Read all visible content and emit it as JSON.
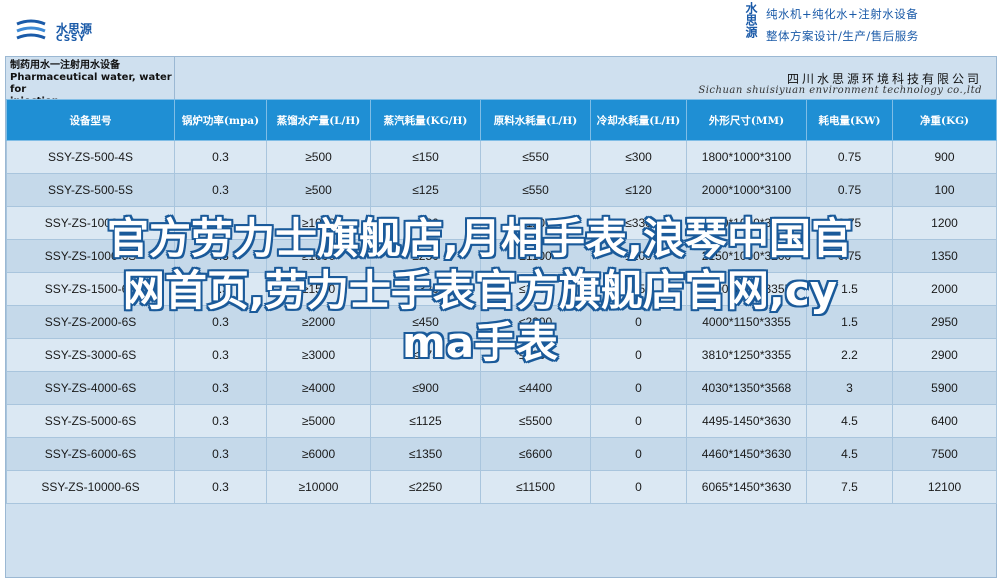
{
  "brand": {
    "name_cn": "水思源",
    "name_en": "CSSY",
    "accent": "#1a5aa8"
  },
  "slogan": {
    "vertical": "水思源",
    "line1": "纯水机+纯化水+注射水设备",
    "line2": "整体方案设计/生产/售后服务"
  },
  "sheet": {
    "title_cn": "制药用水一注射用水设备",
    "title_en_1": "Pharmaceutical water, water for",
    "title_en_2": "injection",
    "company_cn": "四川水思源环境科技有限公司",
    "company_en": "Sichuan shuisiyuan environment technology co.,ltd"
  },
  "table": {
    "headers": [
      "设备型号",
      "锅炉功率(mpa)",
      "蒸馏水产量(L/H)",
      "蒸汽耗量(KG/H)",
      "原料水耗量(L/H)",
      "冷却水耗量(L/H)",
      "外形尺寸(MM)",
      "耗电量(KW)",
      "净重(KG)"
    ],
    "rows": [
      [
        "SSY-ZS-500-4S",
        "0.3",
        "≥500",
        "≤150",
        "≤550",
        "≤300",
        "1800*1000*3100",
        "0.75",
        "900"
      ],
      [
        "SSY-ZS-500-5S",
        "0.3",
        "≥500",
        "≤125",
        "≤550",
        "≤120",
        "2000*1000*3100",
        "0.75",
        "100"
      ],
      [
        "SSY-ZS-1000-5S",
        "0.3",
        "≥1000",
        "≤280",
        "≤1100",
        "≤330",
        "2000*1000*3100",
        "0.75",
        "1200"
      ],
      [
        "SSY-ZS-1000-6S",
        "0.3",
        "≥1000",
        "≤250",
        "≤1100",
        "≤100",
        "2150*1000*3200",
        "0.75",
        "1350"
      ],
      [
        "SSY-ZS-1500-6S",
        "0.3",
        "≥1500",
        "≤320",
        "≤1650",
        "≤150",
        "3000*1000*3355",
        "1.5",
        "2000"
      ],
      [
        "SSY-ZS-2000-6S",
        "0.3",
        "≥2000",
        "≤450",
        "≤2200",
        "0",
        "4000*1150*3355",
        "1.5",
        "2950"
      ],
      [
        "SSY-ZS-3000-6S",
        "0.3",
        "≥3000",
        "≤675",
        "≤3300",
        "0",
        "3810*1250*3355",
        "2.2",
        "2900"
      ],
      [
        "SSY-ZS-4000-6S",
        "0.3",
        "≥4000",
        "≤900",
        "≤4400",
        "0",
        "4030*1350*3568",
        "3",
        "5900"
      ],
      [
        "SSY-ZS-5000-6S",
        "0.3",
        "≥5000",
        "≤1125",
        "≤5500",
        "0",
        "4495-1450*3630",
        "4.5",
        "6400"
      ],
      [
        "SSY-ZS-6000-6S",
        "0.3",
        "≥6000",
        "≤1350",
        "≤6600",
        "0",
        "4460*1450*3630",
        "4.5",
        "7500"
      ],
      [
        "SSY-ZS-10000-6S",
        "0.3",
        "≥10000",
        "≤2250",
        "≤11500",
        "0",
        "6065*1450*3630",
        "7.5",
        "12100"
      ]
    ]
  },
  "overlay": {
    "line1": "官方劳力士旗舰店,月相手表,浪琴中国官",
    "line2": "网首页,劳力士手表官方旗舰店官网,cy",
    "line3": "ma手表"
  }
}
